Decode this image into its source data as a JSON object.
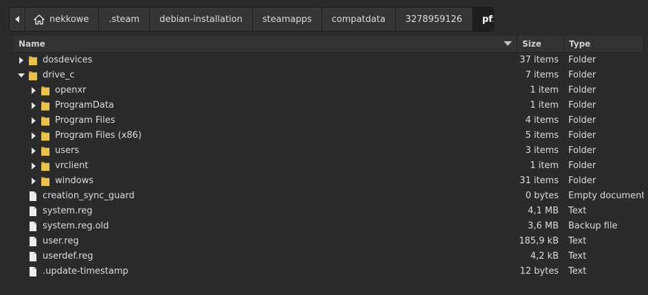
{
  "breadcrumb": {
    "items": [
      "nekkowe",
      ".steam",
      "debian-installation",
      "steamapps",
      "compatdata",
      "3278959126",
      "pfx"
    ]
  },
  "columns": {
    "name": "Name",
    "size": "Size",
    "type": "Type"
  },
  "rows": [
    {
      "name": "dosdevices",
      "size": "37 items",
      "type": "Folder",
      "kind": "folder",
      "depth": 0,
      "expanded": false
    },
    {
      "name": "drive_c",
      "size": "7 items",
      "type": "Folder",
      "kind": "folder",
      "depth": 0,
      "expanded": true
    },
    {
      "name": "openxr",
      "size": "1 item",
      "type": "Folder",
      "kind": "folder",
      "depth": 1,
      "expanded": false
    },
    {
      "name": "ProgramData",
      "size": "1 item",
      "type": "Folder",
      "kind": "folder",
      "depth": 1,
      "expanded": false
    },
    {
      "name": "Program Files",
      "size": "4 items",
      "type": "Folder",
      "kind": "folder",
      "depth": 1,
      "expanded": false
    },
    {
      "name": "Program Files (x86)",
      "size": "5 items",
      "type": "Folder",
      "kind": "folder",
      "depth": 1,
      "expanded": false
    },
    {
      "name": "users",
      "size": "3 items",
      "type": "Folder",
      "kind": "folder",
      "depth": 1,
      "expanded": false
    },
    {
      "name": "vrclient",
      "size": "1 item",
      "type": "Folder",
      "kind": "folder",
      "depth": 1,
      "expanded": false
    },
    {
      "name": "windows",
      "size": "31 items",
      "type": "Folder",
      "kind": "folder",
      "depth": 1,
      "expanded": false
    },
    {
      "name": "creation_sync_guard",
      "size": "0 bytes",
      "type": "Empty document",
      "kind": "file",
      "depth": 0
    },
    {
      "name": "system.reg",
      "size": "4,1 MB",
      "type": "Text",
      "kind": "file",
      "depth": 0
    },
    {
      "name": "system.reg.old",
      "size": "3,6 MB",
      "type": "Backup file",
      "kind": "file",
      "depth": 0
    },
    {
      "name": "user.reg",
      "size": "185,9 kB",
      "type": "Text",
      "kind": "file",
      "depth": 0
    },
    {
      "name": "userdef.reg",
      "size": "4,2 kB",
      "type": "Text",
      "kind": "file",
      "depth": 0
    },
    {
      "name": ".update-timestamp",
      "size": "12 bytes",
      "type": "Text",
      "kind": "file",
      "depth": 0
    }
  ],
  "colors": {
    "folder": "#e8c24a",
    "folder_dark": "#c99a20",
    "file": "#eeeeee",
    "background": "#2b2b2b"
  }
}
